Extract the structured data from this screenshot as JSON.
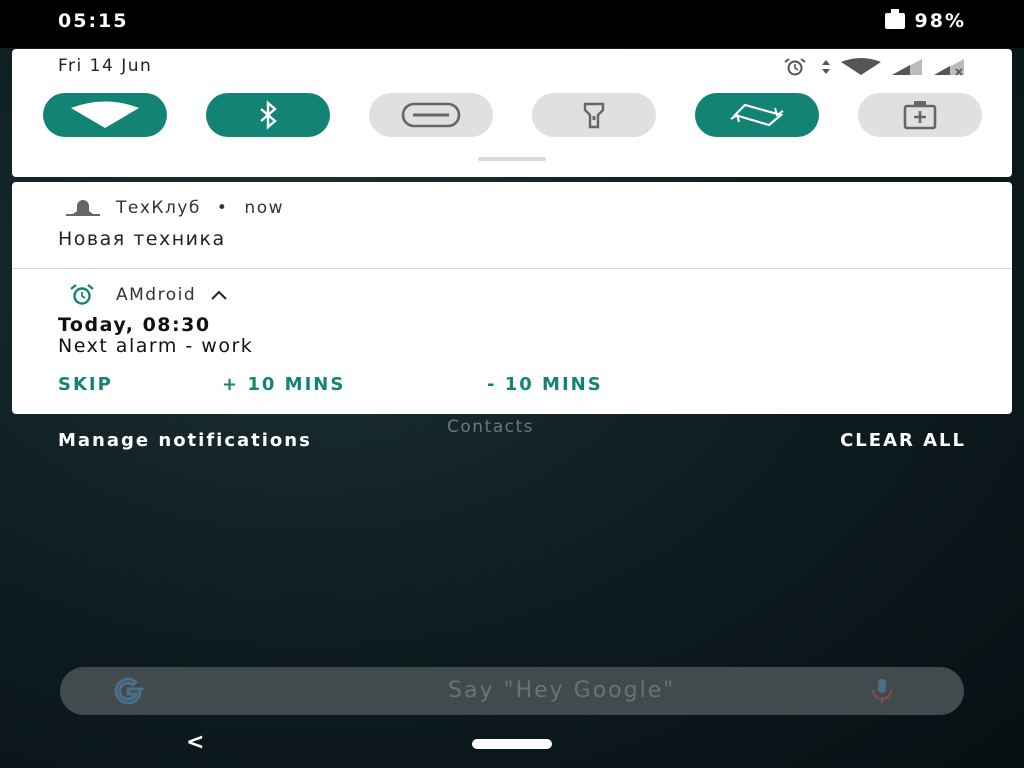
{
  "status_bar": {
    "time": "05:15",
    "battery": "98%"
  },
  "quick_settings": {
    "date": "Fri 14 Jun",
    "tiles": [
      {
        "name": "wifi",
        "active": true
      },
      {
        "name": "bluetooth",
        "active": true
      },
      {
        "name": "do-not-disturb",
        "active": false
      },
      {
        "name": "flashlight",
        "active": false
      },
      {
        "name": "auto-rotate",
        "active": true
      },
      {
        "name": "battery-saver",
        "active": false
      }
    ],
    "accent_color": "#138473"
  },
  "notifications": {
    "techclub": {
      "app": "ТехКлуб",
      "time": "now",
      "title": "Новая техника"
    },
    "amdroid": {
      "app": "AMdroid",
      "title": "Today, 08:30",
      "text": "Next alarm - work",
      "actions": [
        "SKIP",
        "+ 10 MINS",
        "- 10 MINS"
      ]
    }
  },
  "footer": {
    "manage": "Manage notifications",
    "clear": "CLEAR ALL"
  },
  "background": {
    "contacts_label": "Contacts"
  },
  "search": {
    "placeholder": "Say \"Hey Google\""
  }
}
